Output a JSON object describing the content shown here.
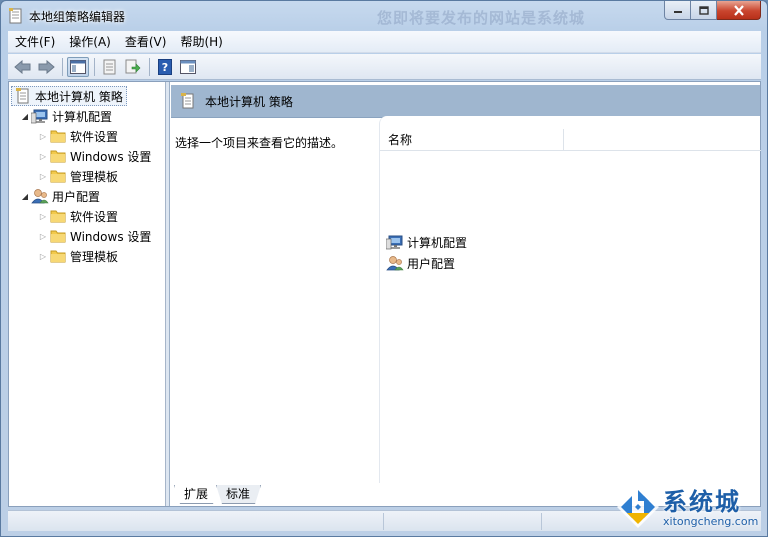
{
  "window": {
    "title": "本地组策略编辑器",
    "title_ghost": "您即将要发布的网站是系统城",
    "controls": {
      "minimize": "minimize",
      "maximize": "maximize",
      "close": "close"
    }
  },
  "menubar": [
    "文件(F)",
    "操作(A)",
    "查看(V)",
    "帮助(H)"
  ],
  "toolbar": {
    "icons": [
      "back-icon",
      "forward-icon",
      "show-hide-tree-icon",
      "properties-icon",
      "export-list-icon",
      "help-icon",
      "show-action-pane-icon"
    ]
  },
  "tree": {
    "root": "本地计算机 策略",
    "computer": {
      "label": "计算机配置",
      "children": [
        "软件设置",
        "Windows 设置",
        "管理模板"
      ]
    },
    "user": {
      "label": "用户配置",
      "children": [
        "软件设置",
        "Windows 设置",
        "管理模板"
      ]
    }
  },
  "right": {
    "header": "本地计算机 策略",
    "description": "选择一个项目来查看它的描述。",
    "column_name": "名称",
    "items": [
      "计算机配置",
      "用户配置"
    ]
  },
  "tabs": [
    "扩展",
    "标准"
  ],
  "watermark": {
    "cn": "系统城",
    "en": "xitongcheng.com"
  },
  "colors": {
    "header_band": "#9fb6cf",
    "folder": "#f2c94c",
    "watermark": "#1e5fa8"
  }
}
